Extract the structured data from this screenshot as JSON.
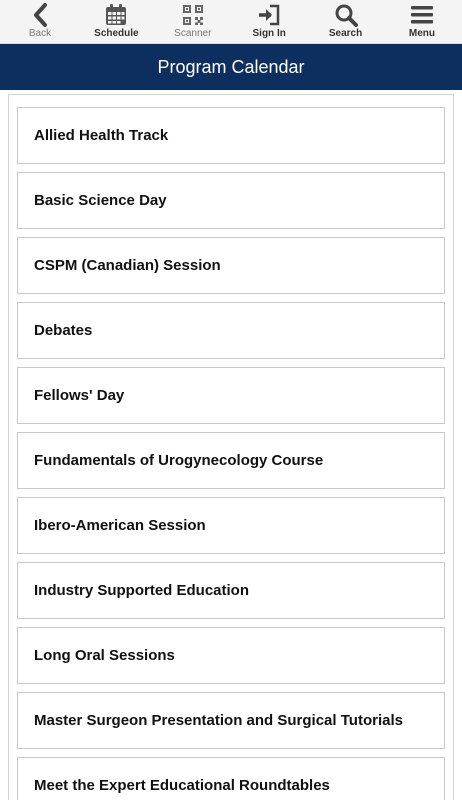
{
  "toolbar": {
    "back_label": "Back",
    "schedule_label": "Schedule",
    "scanner_label": "Scanner",
    "signin_label": "Sign In",
    "search_label": "Search",
    "menu_label": "Menu"
  },
  "page_title": "Program Calendar",
  "colors": {
    "title_bar_bg": "#0c2f60",
    "toolbar_bg": "#f4f4f4"
  },
  "items": [
    {
      "label": "Allied Health Track"
    },
    {
      "label": "Basic Science Day"
    },
    {
      "label": "CSPM (Canadian) Session"
    },
    {
      "label": "Debates"
    },
    {
      "label": "Fellows' Day"
    },
    {
      "label": "Fundamentals of Urogynecology Course"
    },
    {
      "label": "Ibero-American Session"
    },
    {
      "label": "Industry Supported Education"
    },
    {
      "label": "Long Oral Sessions"
    },
    {
      "label": "Master Surgeon Presentation and Surgical Tutorials"
    },
    {
      "label": "Meet the Expert Educational Roundtables"
    }
  ]
}
